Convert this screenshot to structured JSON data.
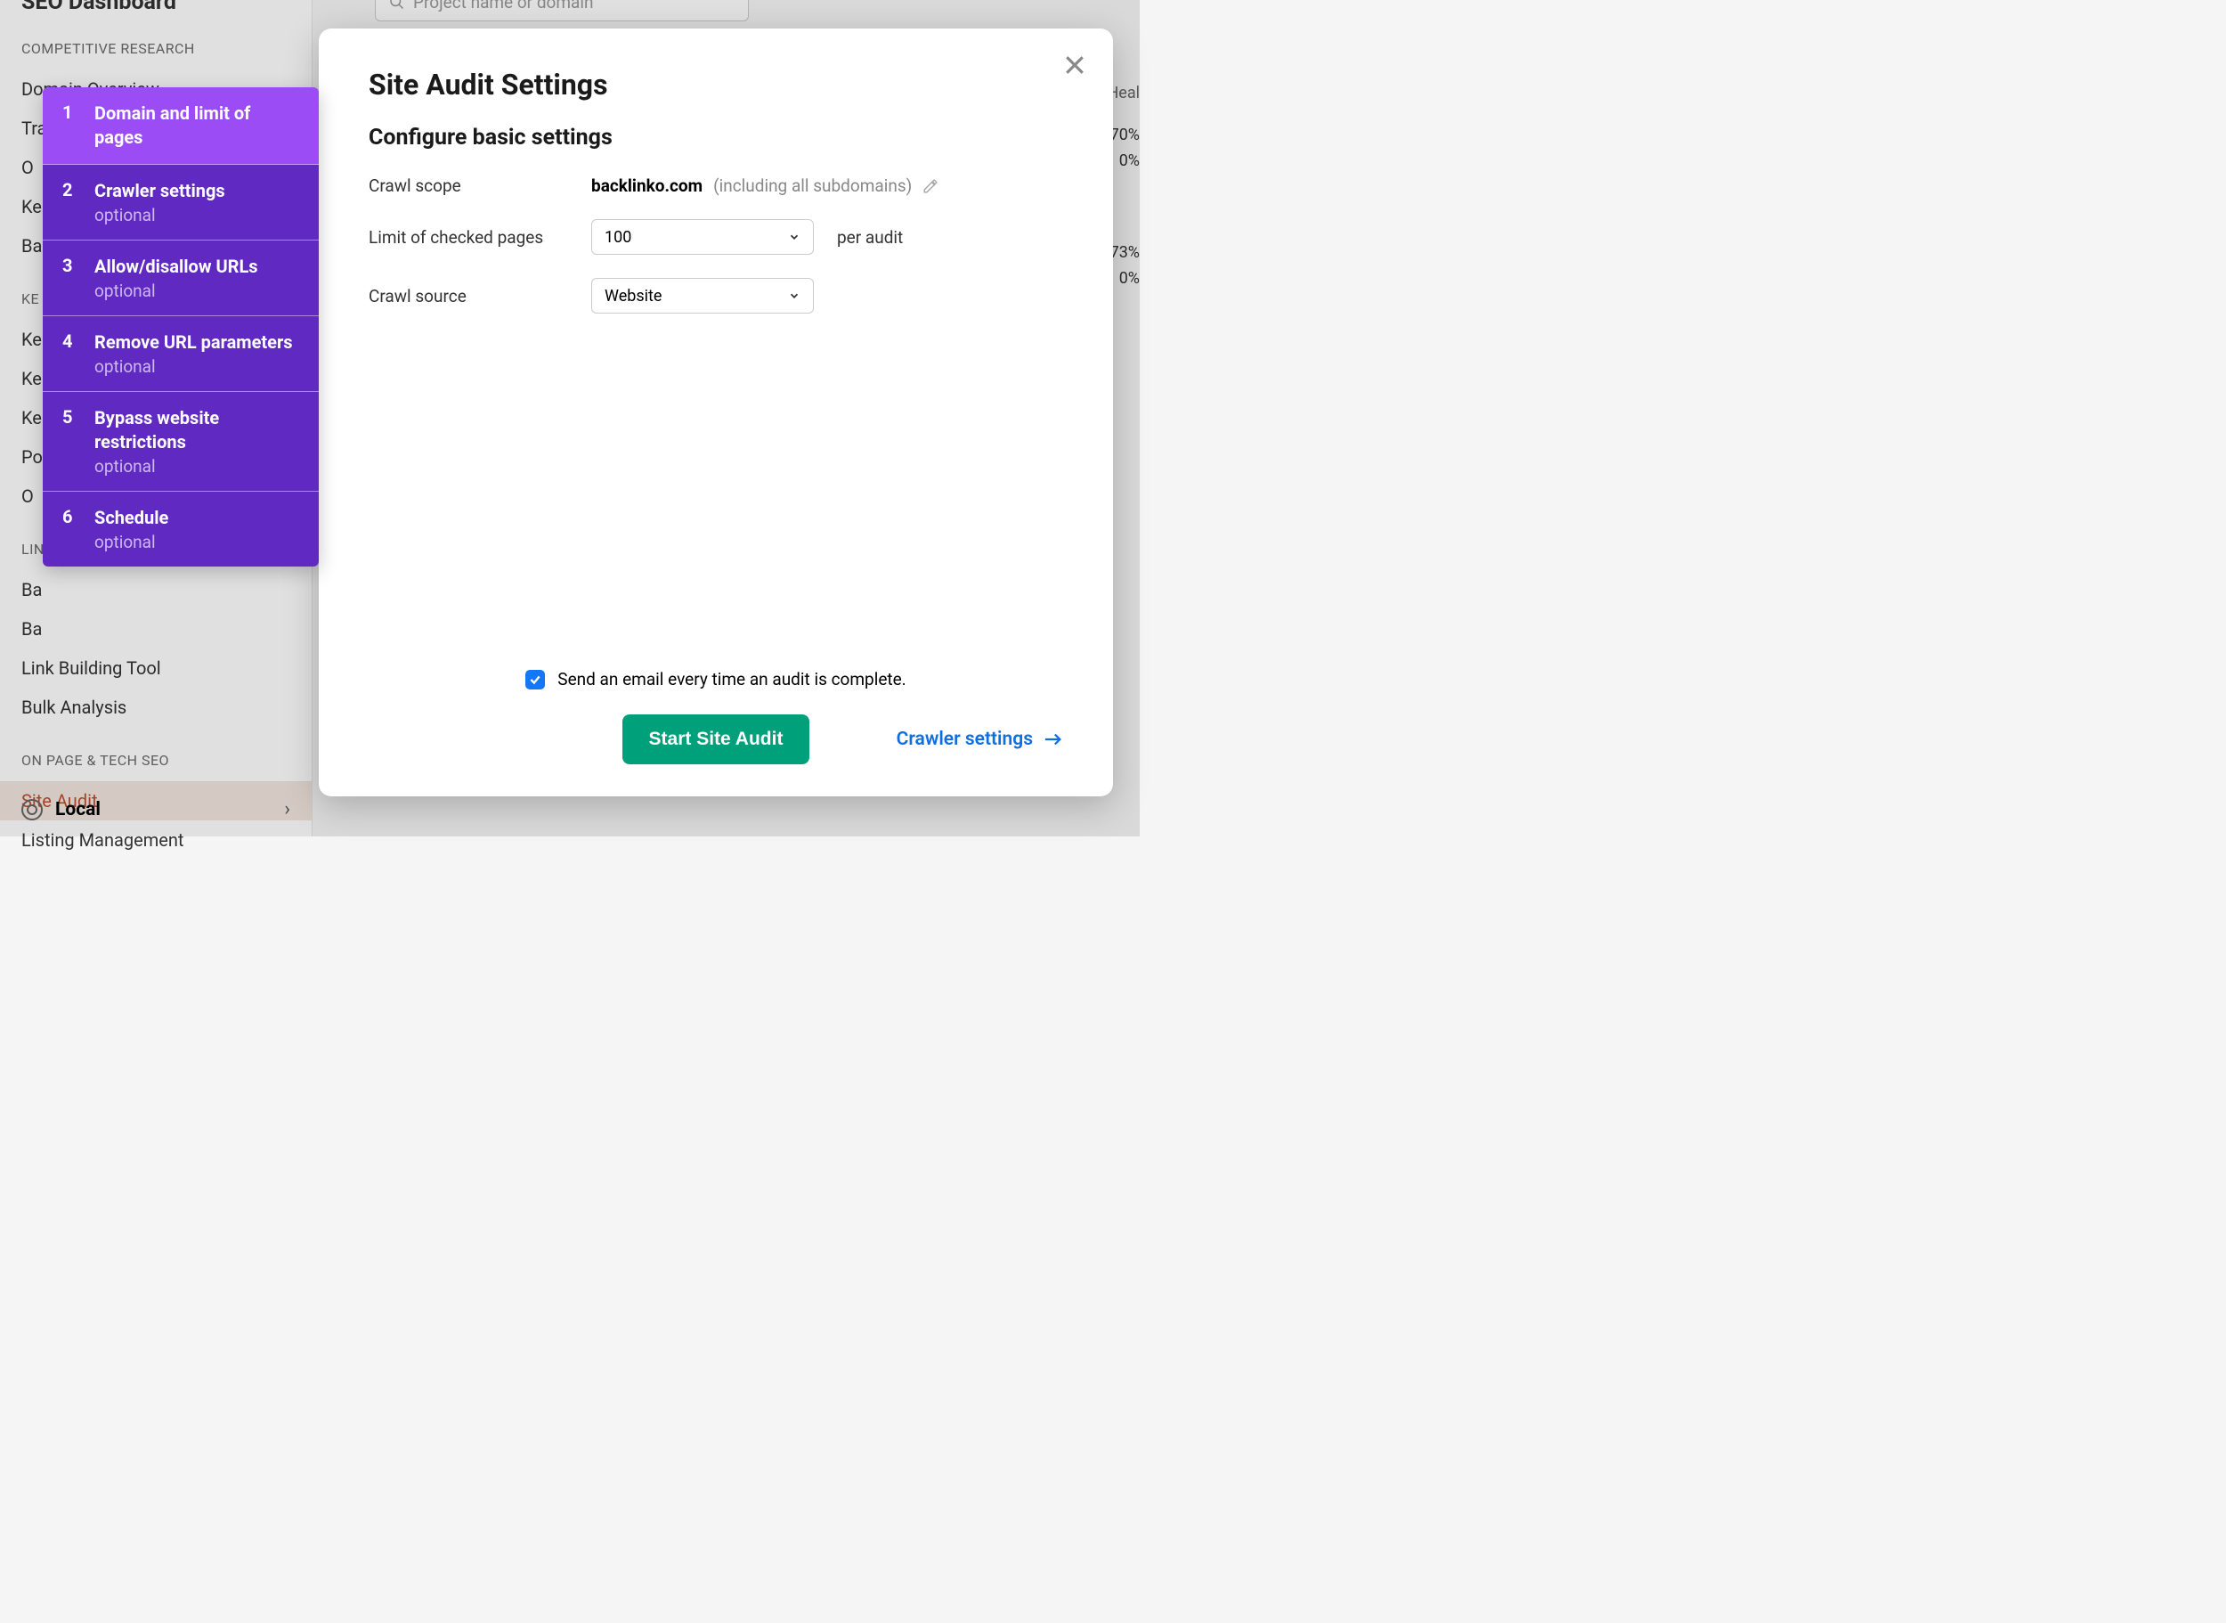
{
  "sidebar": {
    "top_cut": "SEO Dashboard",
    "sections": [
      {
        "label": "COMPETITIVE RESEARCH",
        "items": [
          "Domain Overview",
          "Tra",
          "O",
          "Ke",
          "Ba"
        ]
      },
      {
        "label": "KE",
        "items": [
          "Ke",
          "Ke",
          "Ke",
          "Po",
          "O"
        ]
      },
      {
        "label": "LIN",
        "items": [
          "Ba",
          "Ba",
          "Link Building Tool",
          "Bulk Analysis"
        ]
      },
      {
        "label": "ON PAGE & TECH SEO",
        "items": [
          "Site Audit",
          "Listing Management"
        ]
      }
    ],
    "active_item": "Site Audit",
    "local": "Local"
  },
  "bg": {
    "search_placeholder": "Project name or domain",
    "right_col": {
      "heading": "Heal",
      "rows": [
        "70%",
        "0%",
        "",
        "73%",
        "0%"
      ]
    }
  },
  "modal": {
    "title": "Site Audit Settings",
    "subtitle": "Configure basic settings",
    "crawl_scope_label": "Crawl scope",
    "crawl_scope_domain": "backlinko.com",
    "crawl_scope_hint": "(including all subdomains)",
    "limit_label": "Limit of checked pages",
    "limit_value": "100",
    "limit_suffix": "per audit",
    "crawl_source_label": "Crawl source",
    "crawl_source_value": "Website",
    "email_checkbox_label": "Send an email every time an audit is complete.",
    "start_button": "Start Site Audit",
    "next_link": "Crawler settings"
  },
  "stepper": [
    {
      "num": "1",
      "title": "Domain and limit of pages",
      "optional": false,
      "active": true
    },
    {
      "num": "2",
      "title": "Crawler settings",
      "optional": true,
      "active": false
    },
    {
      "num": "3",
      "title": "Allow/disallow URLs",
      "optional": true,
      "active": false
    },
    {
      "num": "4",
      "title": "Remove URL parameters",
      "optional": true,
      "active": false
    },
    {
      "num": "5",
      "title": "Bypass website restrictions",
      "optional": true,
      "active": false
    },
    {
      "num": "6",
      "title": "Schedule",
      "optional": true,
      "active": false
    }
  ],
  "optional_label": "optional"
}
